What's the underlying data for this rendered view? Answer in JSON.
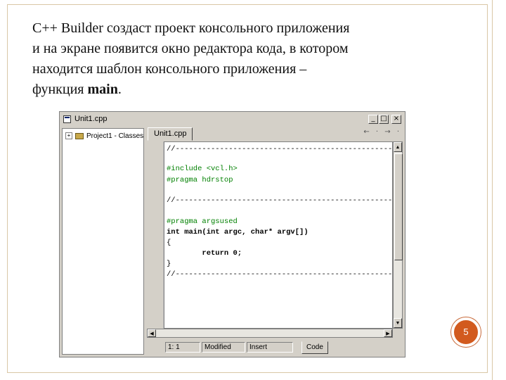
{
  "slide": {
    "line1": "C++ Builder создаст проект консольного приложения",
    "line2": "и на экране появится окно редактора кода, в котором",
    "line3": "находится шаблон консольного приложения –",
    "line4_prefix": "функция ",
    "line4_bold": "main",
    "line4_suffix": ".",
    "page_number": "5"
  },
  "window": {
    "title": "Unit1.cpp",
    "btn_minimize": "_",
    "btn_maximize": "□",
    "btn_close": "×"
  },
  "tree": {
    "item_label": "Project1 - Classes",
    "expander": "+"
  },
  "editor": {
    "tab_label": "Unit1.cpp",
    "nav_arrows": "← · → ·",
    "lines": [
      "//---------------------------------------------------------------------------",
      "#include <vcl.h>",
      "#pragma hdrstop",
      "//---------------------------------------------------------------------------",
      "#pragma argsused",
      "int main(int argc, char* argv[])",
      "{",
      "        return 0;",
      "}",
      "//---------------------------------------------------------------------------"
    ]
  },
  "status": {
    "position": "1: 1",
    "state": "Modified",
    "mode": "Insert",
    "code_tab": "Code"
  },
  "colors": {
    "directive": "#008000",
    "badge": "#d25a1e"
  }
}
